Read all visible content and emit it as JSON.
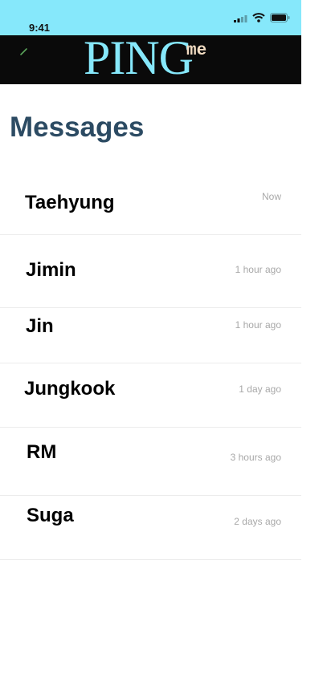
{
  "status_bar": {
    "time": "9:41",
    "icons": [
      "cellular-signal-icon",
      "wifi-icon",
      "battery-icon"
    ]
  },
  "header": {
    "logo_main": "PING",
    "logo_sup": "me",
    "edit_icon": "pencil-icon"
  },
  "page_title": "Messages",
  "colors": {
    "status_bar_bg": "#86e8fb",
    "header_bg": "#0a0a0a",
    "logo_main": "#86e8fb",
    "logo_sup": "#f2dcc2",
    "title": "#2c4b63",
    "timestamp": "#a8a8a8"
  },
  "messages": [
    {
      "name": "Taehyung",
      "time": "Now"
    },
    {
      "name": "Jimin",
      "time": "1 hour ago"
    },
    {
      "name": "Jin",
      "time": "1 hour ago"
    },
    {
      "name": "Jungkook",
      "time": "1 day ago"
    },
    {
      "name": "RM",
      "time": "3 hours ago"
    },
    {
      "name": "Suga",
      "time": "2 days ago"
    }
  ]
}
